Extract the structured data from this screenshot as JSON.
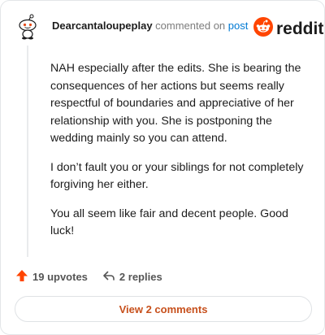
{
  "header": {
    "username": "Dearcantaloupeplay",
    "commented_on": "commented on",
    "post_link": "post"
  },
  "brand": {
    "wordmark": "reddit",
    "logo_icon": "reddit-logo-icon",
    "color": "#ff4500"
  },
  "avatar": {
    "icon": "snoo-avatar-icon"
  },
  "comment": {
    "paragraphs": [
      "NAH especially after the edits. She is bearing the consequences of her actions but seems really respectful of boundaries and appreciative of her relationship with you. She is postponing the wedding mainly so you can attend.",
      "I don’t fault you or your siblings for not completely forgiving her either.",
      "You all seem like fair and decent people. Good luck!"
    ]
  },
  "actions": {
    "upvotes": "19 upvotes",
    "upvote_icon": "upvote-arrow-icon",
    "upvote_color": "#ff4500",
    "replies": "2 replies",
    "reply_icon": "reply-arrow-icon"
  },
  "footer": {
    "view_comments": "View 2 comments",
    "accent": "#c7501c"
  }
}
